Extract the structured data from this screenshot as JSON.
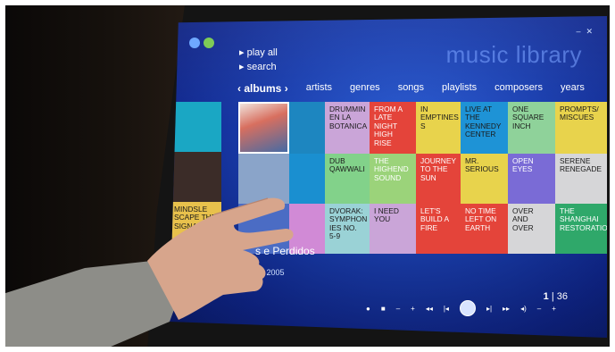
{
  "screen": {
    "app_title": "music library",
    "quick_actions": [
      "play all",
      "search"
    ],
    "nav": {
      "items": [
        "albums",
        "artists",
        "genres",
        "songs",
        "playlists",
        "composers",
        "years"
      ],
      "active": "albums"
    },
    "albums": [
      {
        "label": "DRUMMIN EN LA BOTANICA",
        "color": "#caa5d8",
        "text_color": "dark"
      },
      {
        "label": "FROM A LATE NIGHT HIGH RISE",
        "color": "#e4443a",
        "text_color": "light"
      },
      {
        "label": "IN EMPTINES S",
        "color": "#e8d34c",
        "text_color": "dark"
      },
      {
        "label": "LIVE AT THE KENNEDY CENTER",
        "color": "#1e93d6",
        "text_color": "dark"
      },
      {
        "label": "ONE SQUARE INCH",
        "color": "#8fd29a",
        "text_color": "dark"
      },
      {
        "label": "PROMPTS/ MISCUES",
        "color": "#e8d34c",
        "text_color": "dark"
      },
      {
        "label": "DUB QAWWALI",
        "color": "#82d28a",
        "text_color": "dark"
      },
      {
        "label": "THE HIGHEND SOUND",
        "color": "#9bd37a",
        "text_color": "light"
      },
      {
        "label": "JOURNEY TO THE SUN",
        "color": "#e4443a",
        "text_color": "light"
      },
      {
        "label": "MR. SERIOUS",
        "color": "#e8d34c",
        "text_color": "dark"
      },
      {
        "label": "OPEN EYES",
        "color": "#7a6bd6",
        "text_color": "light"
      },
      {
        "label": "SERENE RENEGADE",
        "color": "#d6d6d8",
        "text_color": "dark"
      },
      {
        "label": "DVORAK: SYMPHON IES NO. 5-9",
        "color": "#9ad2d6",
        "text_color": "dark"
      },
      {
        "label": "I NEED YOU",
        "color": "#caa5d8",
        "text_color": "dark"
      },
      {
        "label": "LET'S BUILD A FIRE",
        "color": "#e4443a",
        "text_color": "light"
      },
      {
        "label": "NO TIME LEFT ON EARTH",
        "color": "#e4443a",
        "text_color": "light"
      },
      {
        "label": "OVER AND OVER",
        "color": "#d6d6d8",
        "text_color": "dark"
      },
      {
        "label": "THE SHANGHAI RESTORATION",
        "color": "#2fa86a",
        "text_color": "light"
      },
      {
        "label": "MINDSLE SCAPE THE SIGNAT",
        "color": "#e8c14c",
        "text_color": "dark"
      }
    ],
    "now_playing": {
      "title": "s e Perdidos",
      "meta": "09   2005"
    },
    "pager": {
      "current": "1",
      "total": "36"
    }
  },
  "colors": {
    "screen_blue": "#1a3fb0",
    "bezel": "#141414",
    "skin": "#d7a58c",
    "sleeve": "#9a9a95"
  }
}
